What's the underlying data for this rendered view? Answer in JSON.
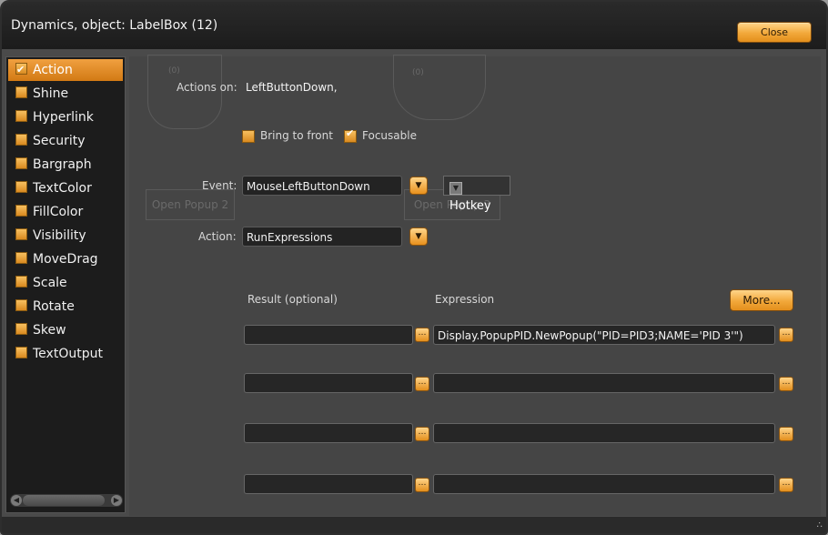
{
  "window": {
    "title": "Dynamics, object: LabelBox (12)",
    "close_label": "Close"
  },
  "sidebar": {
    "items": [
      {
        "label": "Action",
        "checked": true
      },
      {
        "label": "Shine"
      },
      {
        "label": "Hyperlink"
      },
      {
        "label": "Security"
      },
      {
        "label": "Bargraph"
      },
      {
        "label": "TextColor"
      },
      {
        "label": "FillColor"
      },
      {
        "label": "Visibility"
      },
      {
        "label": "MoveDrag"
      },
      {
        "label": "Scale"
      },
      {
        "label": "Rotate"
      },
      {
        "label": "Skew"
      },
      {
        "label": "TextOutput"
      }
    ]
  },
  "background_ghost": {
    "popup2": "Open Popup 2",
    "popup3": "Open Popup 3",
    "tank1": "(0)",
    "tank2": "(0)"
  },
  "form": {
    "actions_on_label": "Actions on:",
    "actions_on_value": "LeftButtonDown,",
    "bring_to_front": "Bring to front",
    "focusable": "Focusable",
    "event_label": "Event:",
    "event_value": "MouseLeftButtonDown",
    "hotkey": "Hotkey",
    "action_label": "Action:",
    "action_value": "RunExpressions",
    "result_header": "Result (optional)",
    "expression_header": "Expression",
    "more_label": "More...",
    "rows": [
      {
        "result": "",
        "expression": "Display.PopupPID.NewPopup(\"PID=PID3;NAME='PID 3'\")"
      },
      {
        "result": "",
        "expression": ""
      },
      {
        "result": "",
        "expression": ""
      },
      {
        "result": "",
        "expression": ""
      }
    ]
  }
}
